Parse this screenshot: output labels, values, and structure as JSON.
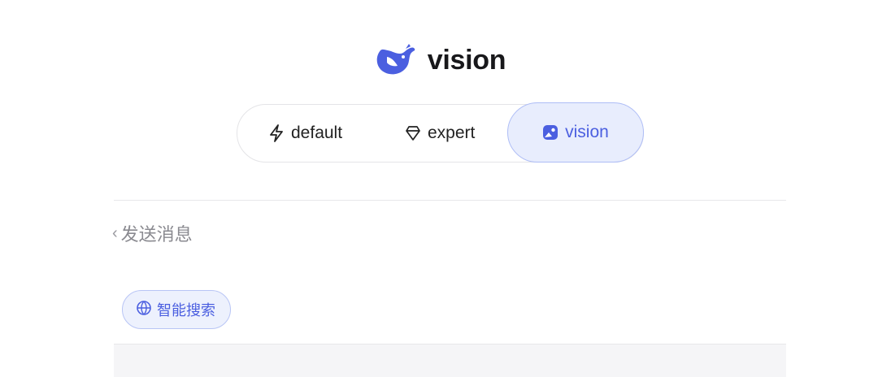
{
  "header": {
    "title": "vision",
    "logo_icon": "whale-logo-icon",
    "accent": "#4b5fe0"
  },
  "modes": [
    {
      "label": "default",
      "icon": "lightning-icon",
      "selected": false
    },
    {
      "label": "expert",
      "icon": "gem-icon",
      "selected": false
    },
    {
      "label": "vision",
      "icon": "image-icon",
      "selected": true
    }
  ],
  "composer": {
    "placeholder": "发送消息",
    "chip": {
      "label": "智能搜索",
      "icon": "globe-icon"
    }
  }
}
